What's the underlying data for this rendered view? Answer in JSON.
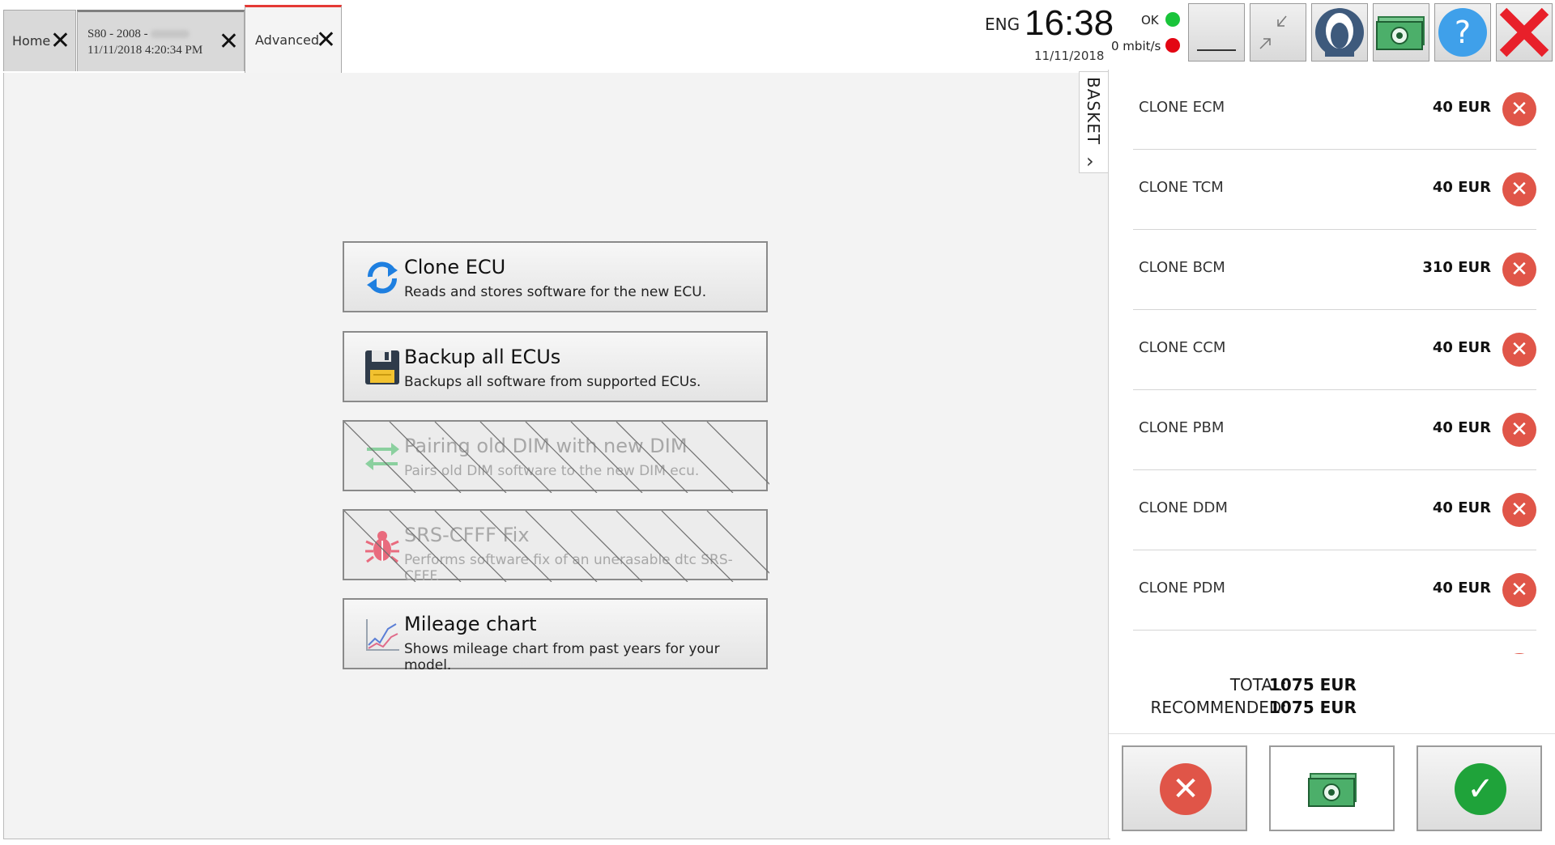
{
  "tabs": [
    {
      "label": "Home"
    },
    {
      "line1": "S80 - 2008 -",
      "line2": "11/11/2018 4:20:34 PM"
    },
    {
      "label": "Advanced"
    }
  ],
  "status": {
    "lang": "ENG",
    "time": "16:38",
    "date": "11/11/2018",
    "ok_label": "OK",
    "speed": "0 mbit/s",
    "ok_color": "#19c43a",
    "speed_color": "#e30613"
  },
  "toolbar": {
    "icons": [
      "minimize-icon",
      "resize-icon",
      "user-icon",
      "money-icon",
      "help-icon",
      "close-app-icon"
    ]
  },
  "functions": [
    {
      "title": "Clone ECU",
      "desc": "Reads and stores software for the new ECU.",
      "enabled": true,
      "icon": "refresh-icon"
    },
    {
      "title": "Backup all ECUs",
      "desc": "Backups all software from supported ECUs.",
      "enabled": true,
      "icon": "floppy-icon"
    },
    {
      "title": "Pairing old DIM with new DIM",
      "desc": "Pairs old DIM software to the new DIM ecu.",
      "enabled": false,
      "icon": "swap-arrows-icon"
    },
    {
      "title": "SRS-CFFF Fix",
      "desc": "Performs software fix of an unerasable dtc SRS-CFFF.",
      "enabled": false,
      "icon": "bug-icon"
    },
    {
      "title": "Mileage chart",
      "desc": "Shows mileage chart from past years for your model.",
      "enabled": true,
      "icon": "chart-icon"
    }
  ],
  "basket": {
    "tab_label": "BASKET",
    "items": [
      {
        "name": "CLONE ECM",
        "price": "40 EUR"
      },
      {
        "name": "CLONE TCM",
        "price": "40 EUR"
      },
      {
        "name": "CLONE BCM",
        "price": "310 EUR"
      },
      {
        "name": "CLONE CCM",
        "price": "40 EUR"
      },
      {
        "name": "CLONE PBM",
        "price": "40 EUR"
      },
      {
        "name": "CLONE DDM",
        "price": "40 EUR"
      },
      {
        "name": "CLONE PDM",
        "price": "40 EUR"
      }
    ],
    "total_label": "TOTAL:",
    "total_value": "1075 EUR",
    "recommended_label": "RECOMMENDED:",
    "recommended_value": "1075 EUR",
    "colors": {
      "remove": "#e05548",
      "confirm": "#1fa33a"
    }
  }
}
